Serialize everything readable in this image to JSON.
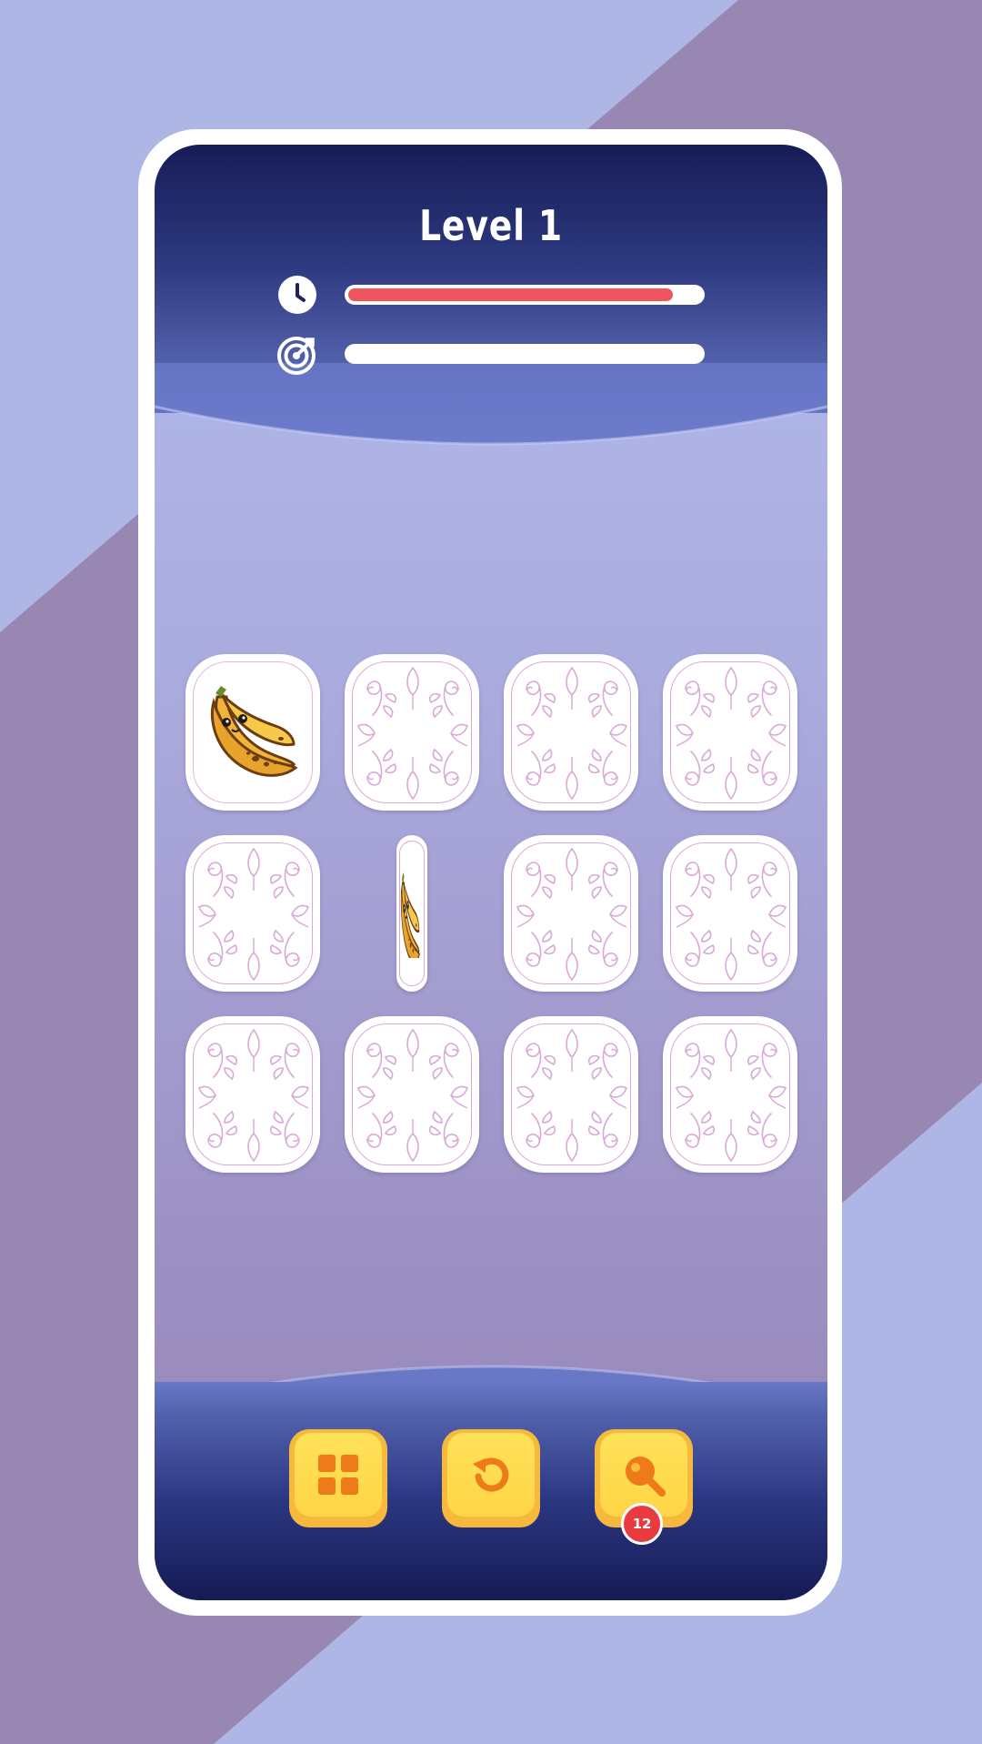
{
  "header": {
    "level_title": "Level 1",
    "timer_progress": 0.92,
    "target_progress": 0.0
  },
  "colors": {
    "background_light": "#aeb6e6",
    "background_dark": "#9987b3",
    "panel_navy": "#171c56",
    "timer_bar": "#ef5560",
    "button_yellow": "#ffd546",
    "button_icon": "#ee7a1a",
    "badge_red": "#e83a3f",
    "card_outline": "#d9a9d6"
  },
  "icons": {
    "timer": "clock-icon",
    "target": "target-icon",
    "menu": "grid-icon",
    "restart": "restart-icon",
    "hint": "magnifier-icon"
  },
  "board": {
    "rows": 3,
    "columns": 4,
    "cards": [
      {
        "state": "face-up",
        "fruit": "banana"
      },
      {
        "state": "face-down"
      },
      {
        "state": "face-down"
      },
      {
        "state": "face-down"
      },
      {
        "state": "face-down"
      },
      {
        "state": "flipping",
        "fruit": "banana"
      },
      {
        "state": "face-down"
      },
      {
        "state": "face-down"
      },
      {
        "state": "face-down"
      },
      {
        "state": "face-down"
      },
      {
        "state": "face-down"
      },
      {
        "state": "face-down"
      }
    ]
  },
  "toolbar": {
    "hint_count": "12"
  }
}
